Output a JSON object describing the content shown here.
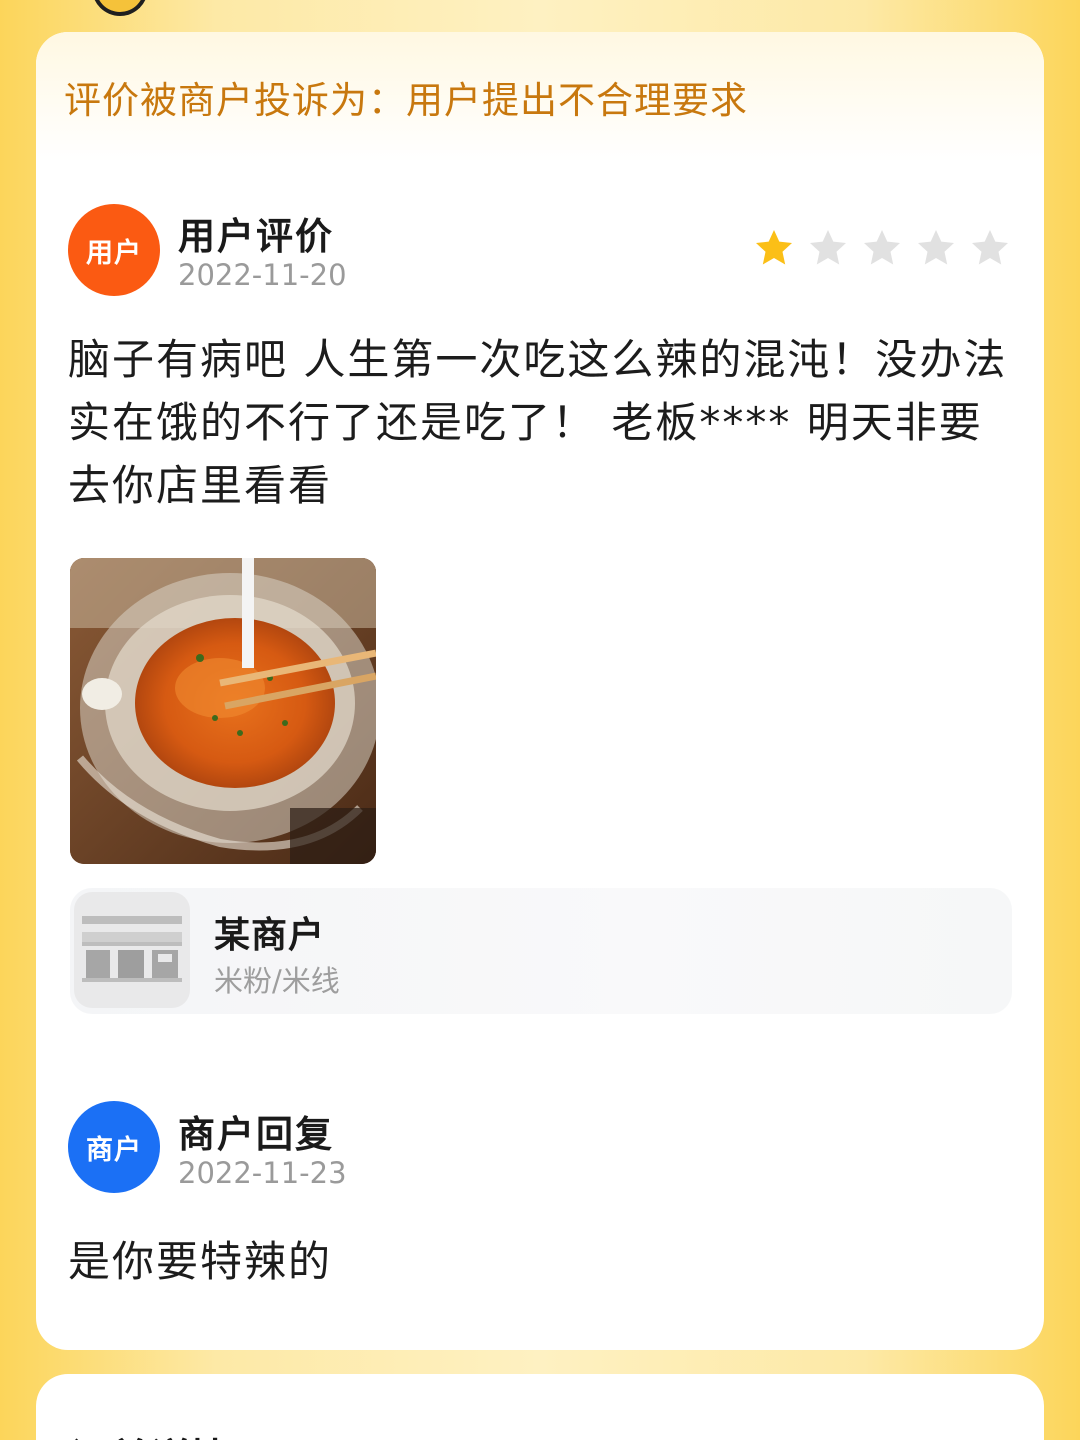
{
  "complaint": {
    "text": "评价被商户投诉为：用户提出不合理要求"
  },
  "user_review": {
    "avatar_label": "用户",
    "title": "用户评价",
    "date": "2022-11-20",
    "rating": 1,
    "rating_max": 5,
    "text": "脑子有病吧 人生第一次吃这么辣的混沌！没办法 实在饿的不行了还是吃了！ 老板**** 明天非要去你店里看看",
    "star_color_filled": "#fbbf17",
    "star_color_empty": "#e1e1e1"
  },
  "shop": {
    "name": "某商户",
    "category": "米粉/米线",
    "thumb_icon": "storefront-icon"
  },
  "merchant_reply": {
    "avatar_label": "商户",
    "title": "商户回复",
    "date": "2022-11-23",
    "text": "是你要特辣的"
  },
  "next_section": {
    "title": "订单详情"
  },
  "colors": {
    "background": "#fbd75f",
    "complaint_text": "#c8780e",
    "user_avatar": "#fb5a12",
    "merchant_avatar": "#1b70f5"
  }
}
